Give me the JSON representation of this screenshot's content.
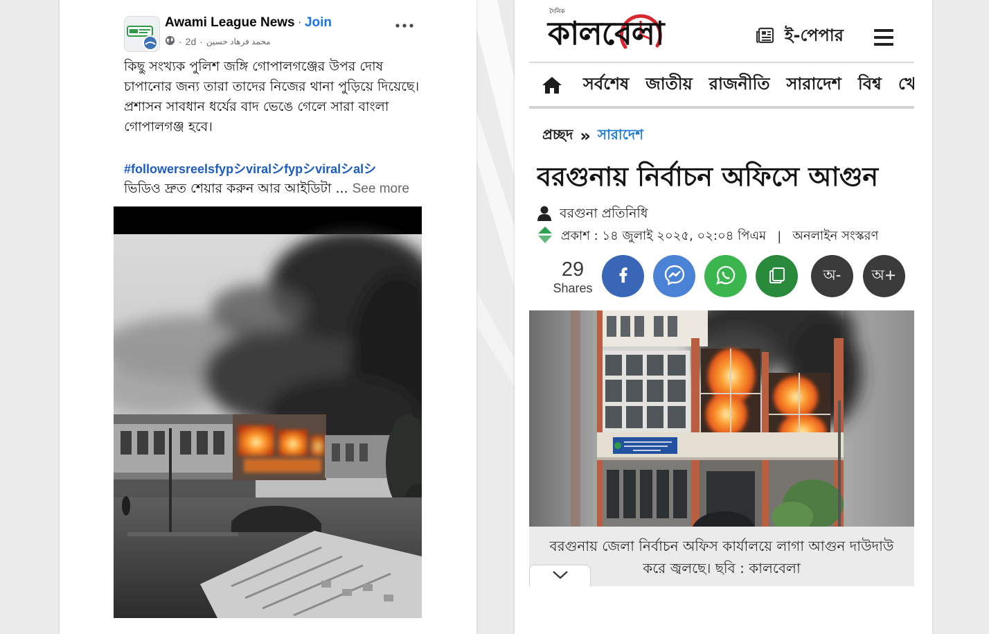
{
  "post": {
    "page_name": "Awami League News",
    "name_separator": "·",
    "join_label": "Join",
    "time_prefix": "·",
    "time": "2d",
    "time_suffix": "·",
    "author": "محمد فرهاد حسين",
    "paragraphs": [
      "কিছু সংখ্যক পুলিশ জঙ্গি গোপালগঞ্জের উপর দোষ চাপানোর জন্য তারা তাদের নিজের থানা পুড়িয়ে দিয়েছে।",
      "প্রশাসন সাবধান ধর্যের বাদ ভেঙে গেলে সারা বাংলা গোপালগঞ্জ হবে।"
    ],
    "hashtags": "#followersreelsfypシviralシfypシviralシalシ",
    "truncated_line": "ভিডিও দ্রুত শেয়ার করুন আর আইডিটা ...",
    "see_more": "See more",
    "icons": [
      "globe-icon",
      "more-options-icon"
    ]
  },
  "article": {
    "logo": {
      "small": "দৈনিক",
      "name": "কালবেলা"
    },
    "epaper_label": "ই-পেপার",
    "nav": [
      "সর্বশেষ",
      "জাতীয়",
      "রাজনীতি",
      "সারাদেশ",
      "বিশ্ব",
      "খেল"
    ],
    "breadcrumb": {
      "home": "প্রচ্ছদ",
      "separator": "»",
      "section": "সারাদেশ"
    },
    "headline": "বরগুনায় নির্বাচন অফিসে আগুন",
    "author": "বরগুনা প্রতিনিধি",
    "published": "প্রকাশ : ১৪ জুলাই ২০২৫, ০২:০৪ পিএম",
    "published_separator": "|",
    "edition": "অনলাইন সংস্করণ",
    "shares": {
      "count": "29",
      "label": "Shares"
    },
    "share_buttons": [
      "facebook-icon",
      "messenger-icon",
      "whatsapp-icon",
      "copy-icon"
    ],
    "font_buttons": {
      "decrease": "অ-",
      "increase": "অ+"
    },
    "caption": "বরগুনায় জেলা নির্বাচন অফিস কার্যালয়ে লাগা আগুন দাউদাউ করে জ্বলছে। ছবি : কালবেলা",
    "icons": [
      "newspaper-icon",
      "menu-icon",
      "home-icon",
      "user-icon",
      "updown-icon",
      "chevron-down-icon"
    ]
  },
  "colors": {
    "fb_join": "#1b74e4",
    "hashtag": "#1d5cbf",
    "breadcrumb_section": "#1e7bd3",
    "kalbela_red": "#d7262e",
    "share_facebook": "#3a66b8",
    "share_messenger": "#4a82d6",
    "share_whatsapp": "#3bb54e",
    "share_copy": "#2a8a3c",
    "font_button": "#3b3b3b"
  }
}
